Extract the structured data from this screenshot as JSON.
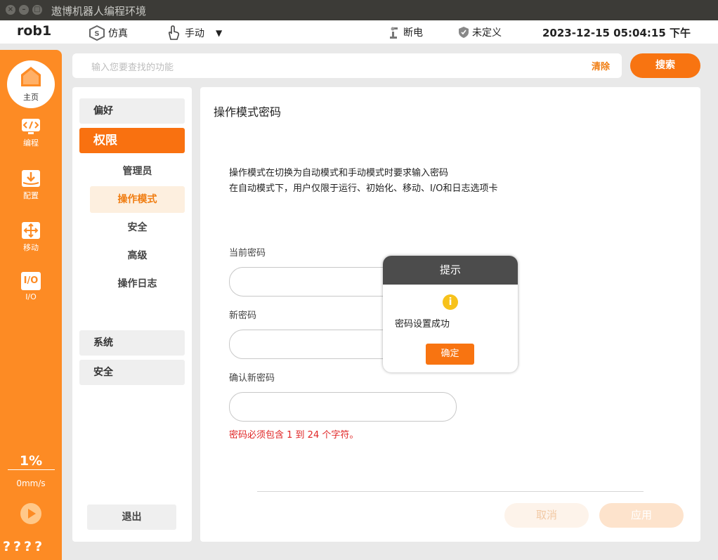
{
  "window": {
    "title": "遨博机器人编程环境"
  },
  "status": {
    "robot": "rob1",
    "sim_label": "仿真",
    "mode_label": "手动",
    "power_label": "断电",
    "safety_label": "未定义",
    "datetime": "2023-12-15 05:04:15 下午"
  },
  "nav": {
    "home": "主页",
    "program": "编程",
    "config": "配置",
    "move": "移动",
    "io": "I/O",
    "io_icon_text": "I/O",
    "speed_pct": "1%",
    "speed": "0mm/s",
    "help": "????"
  },
  "search": {
    "placeholder": "输入您要查找的功能",
    "clear": "清除",
    "button": "搜索"
  },
  "menu": {
    "preferences": "偏好",
    "permissions": "权限",
    "sub": [
      "管理员",
      "操作模式",
      "安全",
      "高级",
      "操作日志"
    ],
    "system": "系统",
    "safety": "安全",
    "logout": "退出"
  },
  "content": {
    "title": "操作模式密码",
    "desc1": "操作模式在切换为自动模式和手动模式时要求输入密码",
    "desc2": "在自动模式下，用户仅限于运行、初始化、移动、I/O和日志选项卡",
    "current_label": "当前密码",
    "new_label": "新密码",
    "confirm_label": "确认新密码",
    "error": "密码必须包含 1 到 24 个字符。",
    "cancel": "取消",
    "apply": "应用"
  },
  "modal": {
    "title": "提示",
    "message": "密码设置成功",
    "ok": "确定"
  },
  "colors": {
    "accent": "#f87411",
    "nav": "#fd8b24",
    "error": "#e02525"
  }
}
